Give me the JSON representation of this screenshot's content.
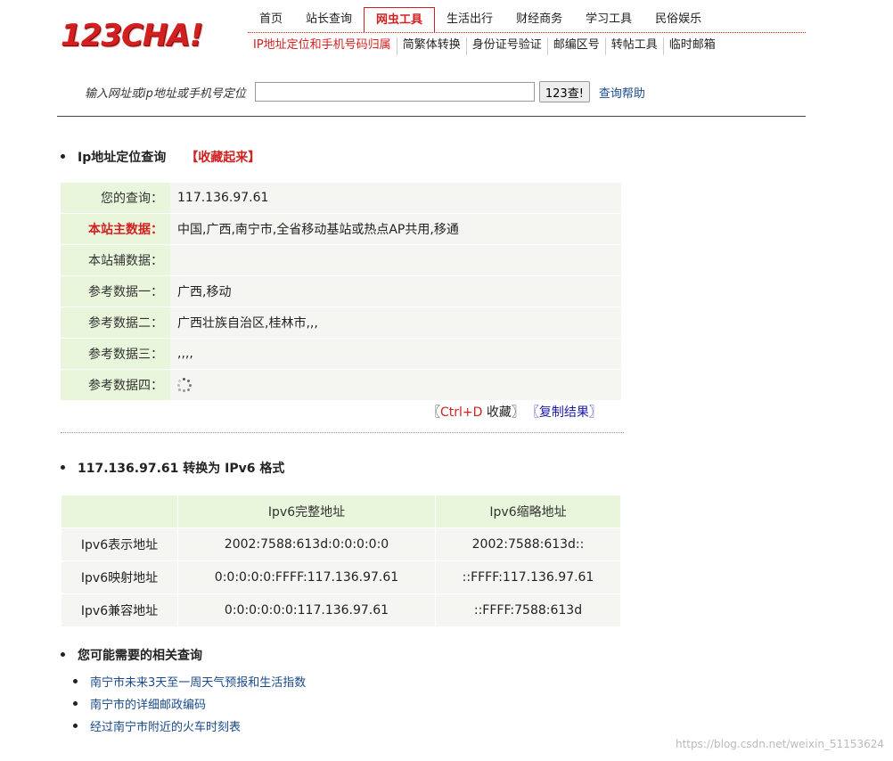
{
  "logo": {
    "text": "123CHA!"
  },
  "nav": {
    "main": [
      "首页",
      "站长查询",
      "网虫工具",
      "生活出行",
      "财经商务",
      "学习工具",
      "民俗娱乐"
    ],
    "active_main": "网虫工具",
    "sub": [
      "IP地址定位和手机号码归属",
      "简繁体转换",
      "身份证号验证",
      "邮编区号",
      "转帖工具",
      "临时邮箱"
    ],
    "active_sub": "IP地址定位和手机号码归属"
  },
  "search": {
    "label": "输入网址或ip地址或手机号定位",
    "value": "",
    "button": "123查!",
    "help": "查询帮助"
  },
  "ip_section": {
    "title": "Ip地址定位查询",
    "bookmark": "【收藏起来】",
    "rows": [
      {
        "key": "您的查询：",
        "value": "117.136.97.61"
      },
      {
        "key": "本站主数据：",
        "value": "中国,广西,南宁市,全省移动基站或热点AP共用,移通"
      },
      {
        "key": "本站辅数据：",
        "value": ""
      },
      {
        "key": "参考数据一：",
        "value": "广西,移动"
      },
      {
        "key": "参考数据二：",
        "value": "广西壮族自治区,桂林市,,,"
      },
      {
        "key": "参考数据三：",
        "value": ",,,,"
      },
      {
        "key": "参考数据四：",
        "value": ""
      }
    ],
    "copy": {
      "open": "〖",
      "ctrl": "Ctrl+D",
      "fav": " 收藏〗",
      "copy_result": "〖复制结果〗"
    }
  },
  "ipv6_section": {
    "title": "117.136.97.61 转换为 IPv6 格式",
    "headers": [
      "",
      "Ipv6完整地址",
      "Ipv6缩略地址"
    ],
    "rows": [
      [
        "Ipv6表示地址",
        "2002:7588:613d:0:0:0:0:0",
        "2002:7588:613d::"
      ],
      [
        "Ipv6映射地址",
        "0:0:0:0:0:FFFF:117.136.97.61",
        "::FFFF:117.136.97.61"
      ],
      [
        "Ipv6兼容地址",
        "0:0:0:0:0:0:117.136.97.61",
        "::FFFF:7588:613d"
      ]
    ]
  },
  "related": {
    "title": "您可能需要的相关查询",
    "links": [
      "南宁市未来3天至一周天气预报和生活指数",
      "南宁市的详细邮政编码",
      "经过南宁市附近的火车时刻表"
    ]
  },
  "watermark": "https://blog.csdn.net/weixin_51153624"
}
